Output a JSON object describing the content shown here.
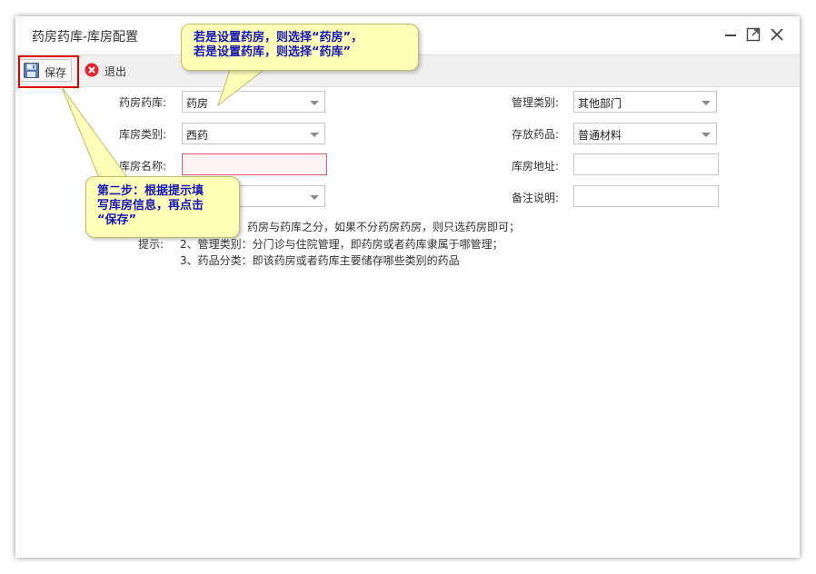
{
  "window": {
    "title": "药房药库-库房配置"
  },
  "toolbar": {
    "save_label": "保存",
    "exit_label": "退出"
  },
  "form": {
    "pharmacy_type": {
      "label": "药房药库:",
      "value": "药房"
    },
    "manage_type": {
      "label": "管理类别:",
      "value": "其他部门"
    },
    "store_category": {
      "label": "库房类别:",
      "value": "西药"
    },
    "stored_drugs": {
      "label": "存放药品:",
      "value": "普通材料"
    },
    "store_name": {
      "label": "库房名称:",
      "value": ""
    },
    "store_address": {
      "label": "库房地址:",
      "value": ""
    },
    "remark": {
      "label": "备注说明:",
      "value": ""
    }
  },
  "hints": {
    "label": "提示:",
    "line1": "药房与药库之分，如果不分药房药房，则只选药房即可；",
    "line2": "2、管理类别：分门诊与住院管理，即药房或者药库隶属于哪管理；",
    "line3": "3、药品分类：即该药房或者药库主要储存哪些类别的药品"
  },
  "callouts": {
    "top_line1": "若是设置药房，则选择“药房”，",
    "top_line2": "若是设置药库，则选择“药库”",
    "step_line1": "第二步：根据提示填",
    "step_line2": "写库房信息，再点击",
    "step_line3": "“保存”"
  },
  "colors": {
    "callout_bg": "#ffffb8",
    "callout_text": "#1515b8",
    "highlight": "#e00000",
    "invalid_border": "#e05a6a"
  }
}
